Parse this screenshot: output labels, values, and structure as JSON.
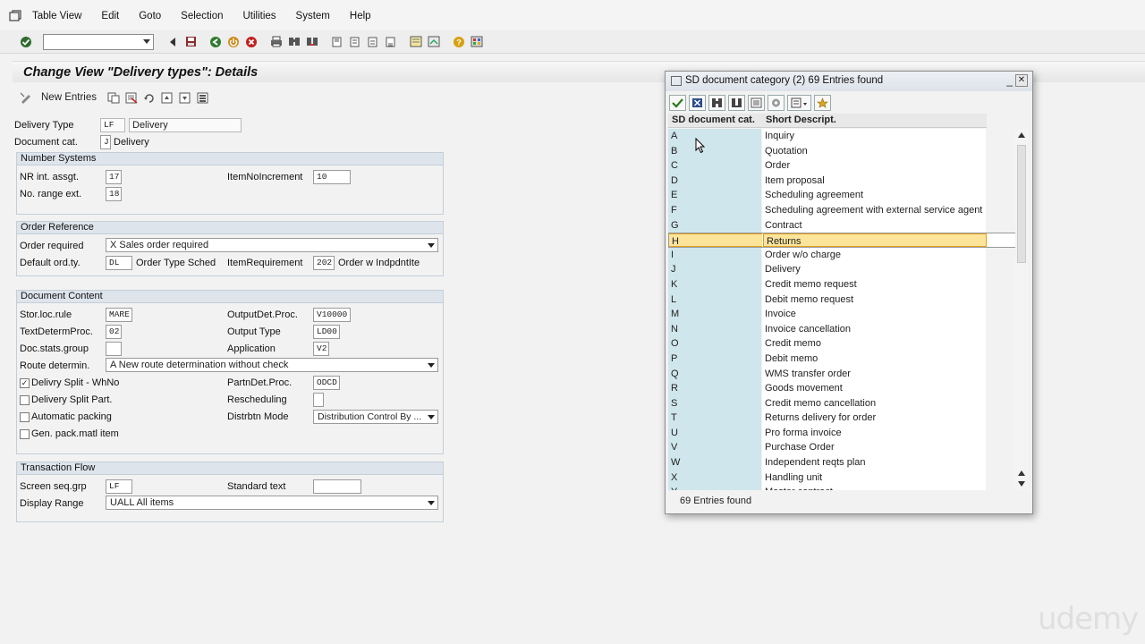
{
  "menu": {
    "items": [
      "Table View",
      "Edit",
      "Goto",
      "Selection",
      "Utilities",
      "System",
      "Help"
    ]
  },
  "toolbar": {
    "command_value": ""
  },
  "title": "Change View \"Delivery types\": Details",
  "app_toolbar": {
    "new_entries": "New Entries"
  },
  "header_fields": {
    "delivery_type_label": "Delivery Type",
    "delivery_type_code": "LF",
    "delivery_type_desc": "Delivery",
    "doc_cat_label": "Document cat.",
    "doc_cat_code": "J",
    "doc_cat_desc": "Delivery"
  },
  "number_systems": {
    "header": "Number Systems",
    "nr_int_label": "NR int. assgt.",
    "nr_int_value": "17",
    "item_inc_label": "ItemNoIncrement",
    "item_inc_value": "10",
    "no_range_ext_label": "No. range ext.",
    "no_range_ext_value": "18"
  },
  "order_reference": {
    "header": "Order Reference",
    "order_required_label": "Order required",
    "order_required_value": "X Sales order required",
    "default_ord_label": "Default ord.ty.",
    "default_ord_value": "DL",
    "order_type_sched_label": "Order Type Sched",
    "item_req_label": "ItemRequirement",
    "item_req_value": "202",
    "item_req_desc": "Order w IndpdntIte"
  },
  "document_content": {
    "header": "Document Content",
    "stor_loc_label": "Stor.loc.rule",
    "stor_loc_value": "MARE",
    "output_det_label": "OutputDet.Proc.",
    "output_det_value": "V10000",
    "text_determ_label": "TextDetermProc.",
    "text_determ_value": "02",
    "output_type_label": "Output Type",
    "output_type_value": "LD00",
    "doc_stats_label": "Doc.stats.group",
    "doc_stats_value": "",
    "application_label": "Application",
    "application_value": "V2",
    "route_label": "Route determin.",
    "route_value": "A New route determination without check",
    "delivry_split_label": "Delivry Split - WhNo",
    "delivry_split_checked": "✓",
    "partn_det_label": "PartnDet.Proc.",
    "partn_det_value": "ODCD",
    "delivery_split_part_label": "Delivery Split Part.",
    "rescheduling_label": "Rescheduling",
    "auto_packing_label": "Automatic packing",
    "distrbtn_mode_label": "Distrbtn Mode",
    "distrbtn_mode_value": "Distribution Control By ...",
    "gen_pack_label": "Gen. pack.matl item"
  },
  "transaction_flow": {
    "header": "Transaction Flow",
    "screen_seq_label": "Screen seq.grp",
    "screen_seq_value": "LF",
    "standard_text_label": "Standard text",
    "standard_text_value": "",
    "display_range_label": "Display Range",
    "display_range_value": "UALL All items"
  },
  "popup": {
    "title": "SD document category (2)   69 Entries found",
    "col1": "SD document cat.",
    "col2": "Short Descript.",
    "status": "69 Entries found",
    "rows": [
      {
        "code": "A",
        "desc": "Inquiry"
      },
      {
        "code": "B",
        "desc": "Quotation"
      },
      {
        "code": "C",
        "desc": "Order"
      },
      {
        "code": "D",
        "desc": "Item proposal"
      },
      {
        "code": "E",
        "desc": "Scheduling agreement"
      },
      {
        "code": "F",
        "desc": "Scheduling agreement with external service agent"
      },
      {
        "code": "G",
        "desc": "Contract"
      },
      {
        "code": "H",
        "desc": "Returns"
      },
      {
        "code": "I",
        "desc": "Order w/o charge"
      },
      {
        "code": "J",
        "desc": "Delivery"
      },
      {
        "code": "K",
        "desc": "Credit memo request"
      },
      {
        "code": "L",
        "desc": "Debit memo request"
      },
      {
        "code": "M",
        "desc": "Invoice"
      },
      {
        "code": "N",
        "desc": "Invoice cancellation"
      },
      {
        "code": "O",
        "desc": "Credit memo"
      },
      {
        "code": "P",
        "desc": "Debit memo"
      },
      {
        "code": "Q",
        "desc": "WMS transfer order"
      },
      {
        "code": "R",
        "desc": "Goods movement"
      },
      {
        "code": "S",
        "desc": "Credit memo cancellation"
      },
      {
        "code": "T",
        "desc": "Returns delivery for order"
      },
      {
        "code": "U",
        "desc": "Pro forma invoice"
      },
      {
        "code": "V",
        "desc": "Purchase Order"
      },
      {
        "code": "W",
        "desc": "Independent reqts plan"
      },
      {
        "code": "X",
        "desc": "Handling unit"
      },
      {
        "code": "Y",
        "desc": "Master contract"
      }
    ],
    "selected_code": "H"
  },
  "watermark": "udemy"
}
